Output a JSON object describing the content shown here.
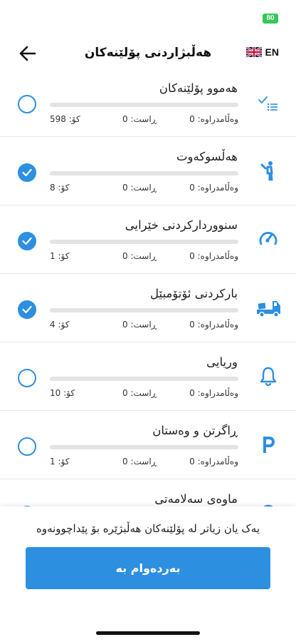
{
  "status_bar": {
    "battery": "80"
  },
  "header": {
    "title": "هەڵبژاردنی پۆلێنەکان",
    "language": "EN"
  },
  "categories": [
    {
      "title": "هەموو پۆلێنەکان",
      "wrong": "وەڵامدراوە: 0",
      "right": "ڕاست: 0",
      "total": "کۆ: 598",
      "selected": false,
      "progress": 0,
      "icon": "list-check-icon"
    },
    {
      "title": "هەڵسوکەوت",
      "wrong": "وەڵامدراوە: 0",
      "right": "ڕاست: 0",
      "total": "کۆ: 8",
      "selected": true,
      "progress": 0,
      "icon": "person-icon"
    },
    {
      "title": "سنووردارکردنی خێرایی",
      "wrong": "وەڵامدراوە: 0",
      "right": "ڕاست: 0",
      "total": "کۆ: 1",
      "selected": true,
      "progress": 0,
      "icon": "speedometer-icon"
    },
    {
      "title": "بارکردنی ئۆتۆمبێل",
      "wrong": "وەڵامدراوە: 0",
      "right": "ڕاست: 0",
      "total": "کۆ: 4",
      "selected": true,
      "progress": 0,
      "icon": "truck-icon"
    },
    {
      "title": "وریایی",
      "wrong": "وەڵامدراوە: 0",
      "right": "ڕاست: 0",
      "total": "کۆ: 10",
      "selected": false,
      "progress": 0,
      "icon": "bell-icon"
    },
    {
      "title": "ڕاگرتن و وەستان",
      "wrong": "وەڵامدراوە: 0",
      "right": "ڕاست: 0",
      "total": "کۆ: 1",
      "selected": false,
      "progress": 0,
      "icon": "parking-icon"
    },
    {
      "title": "ماوەی سەلامەتی",
      "wrong": "",
      "right": "",
      "total": "",
      "selected": false,
      "progress": 0,
      "icon": "distance-icon"
    }
  ],
  "footer": {
    "hint": "یەک یان زیاتر لە پۆلێنەکان هەڵبژێرە بۆ پێداچوونەوە",
    "continue_label": "بەردەوام بە"
  },
  "colors": {
    "accent": "#2d8fe0",
    "track": "#e3e3e3",
    "battery": "#34c759"
  }
}
